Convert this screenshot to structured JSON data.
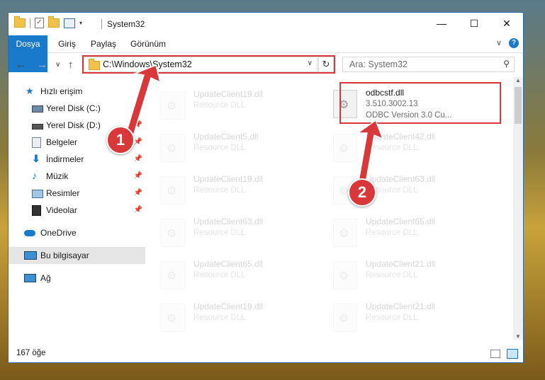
{
  "window": {
    "title": "System32",
    "minimize_glyph": "—",
    "maximize_glyph": "☐",
    "close_glyph": "✕"
  },
  "ribbon": {
    "tabs": [
      "Dosya",
      "Giriş",
      "Paylaş",
      "Görünüm"
    ],
    "collapse_glyph": "∨",
    "help_glyph": "?"
  },
  "nav": {
    "back_glyph": "←",
    "forward_glyph": "→",
    "recent_glyph": "∨",
    "up_glyph": "↑",
    "address_path": "C:\\Windows\\System32",
    "refresh_glyph": "↻",
    "search_placeholder": "Ara: System32"
  },
  "sidebar": {
    "items": [
      {
        "label": "Hızlı erişim",
        "icon": "star-icon"
      },
      {
        "label": "Yerel Disk (C:)",
        "icon": "drive-icon"
      },
      {
        "label": "Yerel Disk (D:)",
        "icon": "drive-icon"
      },
      {
        "label": "Belgeler",
        "icon": "documents-icon"
      },
      {
        "label": "İndirmeler",
        "icon": "download-icon"
      },
      {
        "label": "Müzik",
        "icon": "music-icon"
      },
      {
        "label": "Resimler",
        "icon": "pictures-icon"
      },
      {
        "label": "Videolar",
        "icon": "video-icon"
      },
      {
        "label": "OneDrive",
        "icon": "cloud-icon"
      },
      {
        "label": "Bu bilgisayar",
        "icon": "computer-icon"
      },
      {
        "label": "Ağ",
        "icon": "network-icon"
      }
    ]
  },
  "files": [
    {
      "name": "UpdateClient19.dll",
      "type": "Resource DLL"
    },
    {
      "name": "odbcstf.dll",
      "version": "3.510.3002.13",
      "desc": "ODBC Version 3.0 Cu..."
    },
    {
      "name": "UpdateClient5.dll",
      "type": "Resource DLL"
    },
    {
      "name": "UpdateClient42.dll",
      "type": "Resource DLL"
    },
    {
      "name": "UpdateClient19.dll",
      "type": "Resource DLL"
    },
    {
      "name": "UpdateClient63.dll",
      "type": "Resource DLL"
    },
    {
      "name": "UpdateClient63.dll",
      "type": "Resource DLL"
    },
    {
      "name": "UpdateClient65.dll",
      "type": "Resource DLL"
    },
    {
      "name": "UpdateClient65.dll",
      "type": "Resource DLL"
    },
    {
      "name": "UpdateClient21.dll",
      "type": "Resource DLL"
    },
    {
      "name": "UpdateClient19.dll",
      "type": "Resource DLL"
    },
    {
      "name": "UpdateClient21.dll",
      "type": "Resource DLL"
    }
  ],
  "status": {
    "count": "167 öğe"
  },
  "callouts": {
    "one": "1",
    "two": "2"
  },
  "colors": {
    "accent": "#1979ca",
    "highlight": "#d8383a"
  }
}
